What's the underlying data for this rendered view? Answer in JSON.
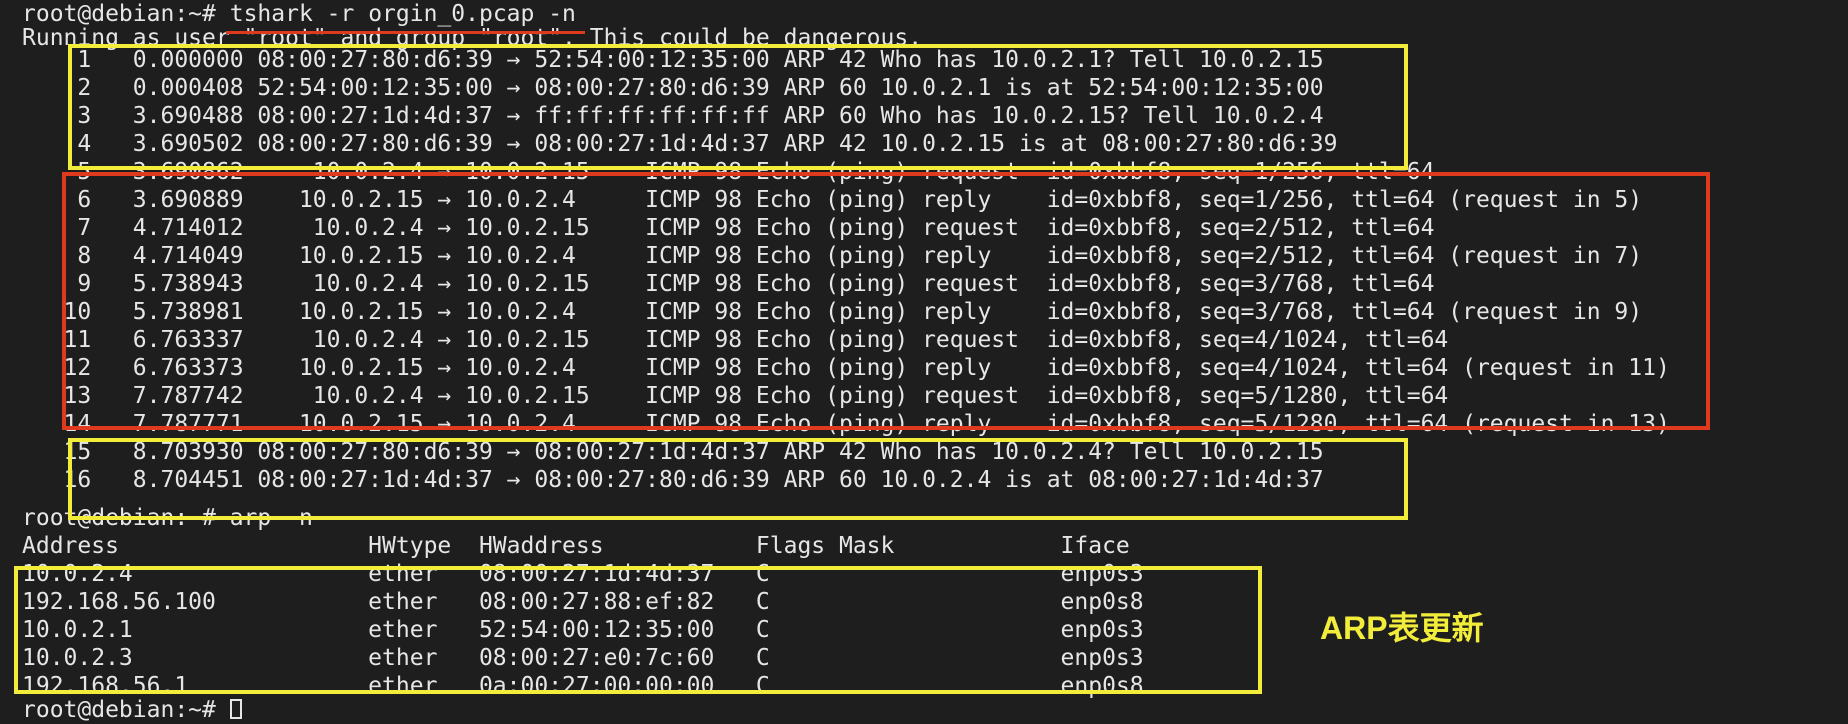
{
  "terminal": {
    "command_prompt": "root@debian:~# ",
    "command": "tshark -r orgin_0.pcap -n",
    "warning": "Running as user \"root\" and group \"root\". This could be dangerous.",
    "packets": [
      "    1   0.000000 08:00:27:80:d6:39 → 52:54:00:12:35:00 ARP 42 Who has 10.0.2.1? Tell 10.0.2.15",
      "    2   0.000408 52:54:00:12:35:00 → 08:00:27:80:d6:39 ARP 60 10.0.2.1 is at 52:54:00:12:35:00",
      "    3   3.690488 08:00:27:1d:4d:37 → ff:ff:ff:ff:ff:ff ARP 60 Who has 10.0.2.15? Tell 10.0.2.4",
      "    4   3.690502 08:00:27:80:d6:39 → 08:00:27:1d:4d:37 ARP 42 10.0.2.15 is at 08:00:27:80:d6:39",
      "    5   3.690862     10.0.2.4 → 10.0.2.15    ICMP 98 Echo (ping) request  id=0xbbf8, seq=1/256, ttl=64",
      "    6   3.690889    10.0.2.15 → 10.0.2.4     ICMP 98 Echo (ping) reply    id=0xbbf8, seq=1/256, ttl=64 (request in 5)",
      "    7   4.714012     10.0.2.4 → 10.0.2.15    ICMP 98 Echo (ping) request  id=0xbbf8, seq=2/512, ttl=64",
      "    8   4.714049    10.0.2.15 → 10.0.2.4     ICMP 98 Echo (ping) reply    id=0xbbf8, seq=2/512, ttl=64 (request in 7)",
      "    9   5.738943     10.0.2.4 → 10.0.2.15    ICMP 98 Echo (ping) request  id=0xbbf8, seq=3/768, ttl=64",
      "   10   5.738981    10.0.2.15 → 10.0.2.4     ICMP 98 Echo (ping) reply    id=0xbbf8, seq=3/768, ttl=64 (request in 9)",
      "   11   6.763337     10.0.2.4 → 10.0.2.15    ICMP 98 Echo (ping) request  id=0xbbf8, seq=4/1024, ttl=64",
      "   12   6.763373    10.0.2.15 → 10.0.2.4     ICMP 98 Echo (ping) reply    id=0xbbf8, seq=4/1024, ttl=64 (request in 11)",
      "   13   7.787742     10.0.2.4 → 10.0.2.15    ICMP 98 Echo (ping) request  id=0xbbf8, seq=5/1280, ttl=64",
      "   14   7.787771    10.0.2.15 → 10.0.2.4     ICMP 98 Echo (ping) reply    id=0xbbf8, seq=5/1280, ttl=64 (request in 13)",
      "   15   8.703930 08:00:27:80:d6:39 → 08:00:27:1d:4d:37 ARP 42 Who has 10.0.2.4? Tell 10.0.2.15",
      "   16   8.704451 08:00:27:1d:4d:37 → 08:00:27:80:d6:39 ARP 60 10.0.2.4 is at 08:00:27:1d:4d:37"
    ],
    "arp_command_line": "root@debian:~# arp -n",
    "arp_header": "Address                  HWtype  HWaddress           Flags Mask            Iface",
    "arp_rows": [
      "10.0.2.4                 ether   08:00:27:1d:4d:37   C                     enp0s3",
      "192.168.56.100           ether   08:00:27:88:ef:82   C                     enp0s8",
      "10.0.2.1                 ether   52:54:00:12:35:00   C                     enp0s3",
      "10.0.2.3                 ether   08:00:27:e0:7c:60   C                     enp0s3",
      "192.168.56.1             ether   0a:00:27:00:00:00   C                     enp0s8"
    ],
    "final_prompt": "root@debian:~# "
  },
  "annotation": {
    "label": "ARP表更新"
  },
  "colors": {
    "background": "#1e1e1e",
    "text": "#e6e6e6",
    "highlight_yellow": "#f2ec3a",
    "highlight_red": "#e03a1e"
  }
}
